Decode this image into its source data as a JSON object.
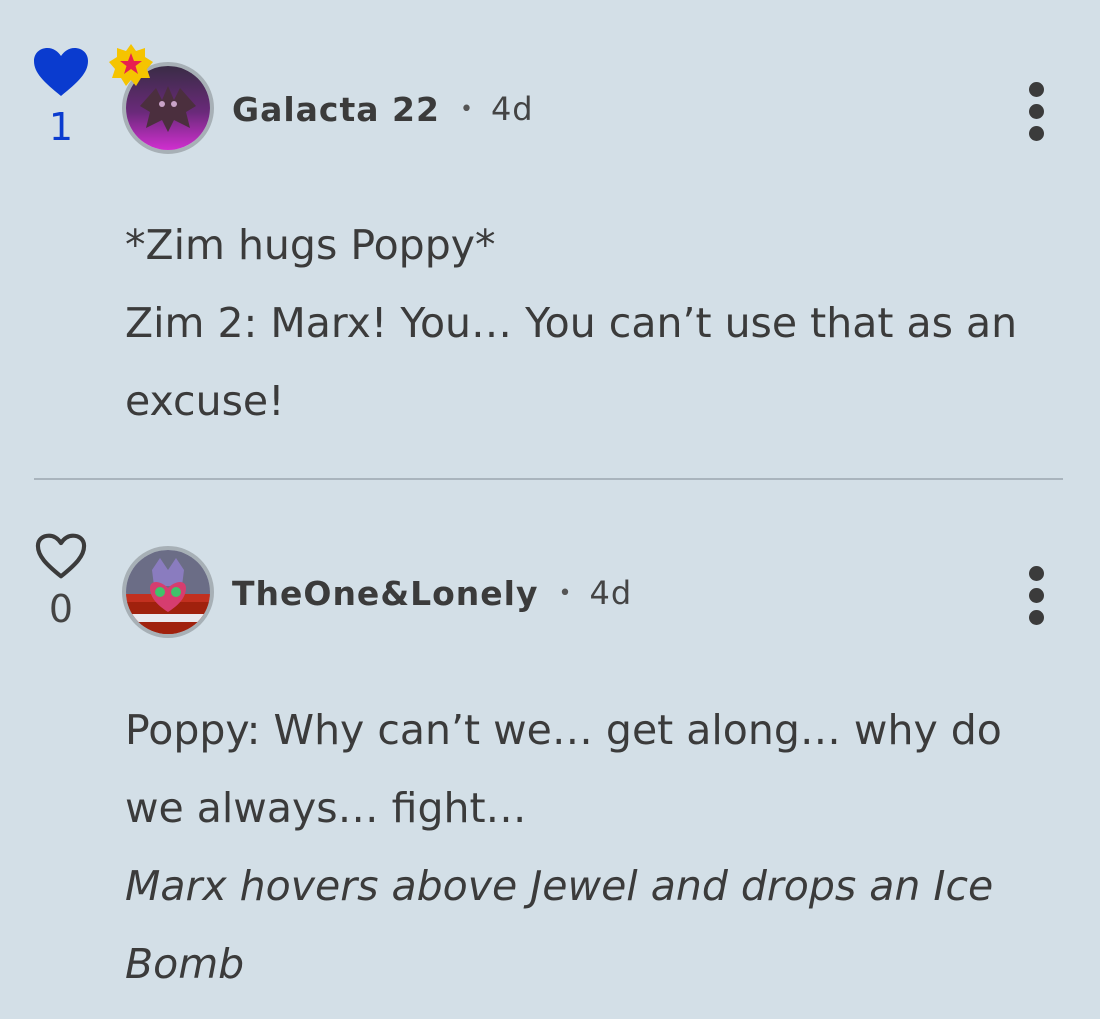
{
  "comments": [
    {
      "author": "Galacta 22",
      "separator": "•",
      "time": "4d",
      "likes": "1",
      "liked": true,
      "badge": "star-badge",
      "lines": [
        "*Zim hugs Poppy*",
        "Zim 2: Marx! You… You can’t use that as an excuse!"
      ]
    },
    {
      "author": "TheOne&Lonely",
      "separator": "•",
      "time": "4d",
      "likes": "0",
      "liked": false,
      "lines": [
        "Poppy: Why can’t we… get along… why do we always… fight…"
      ],
      "italic_lines": [
        "Marx hovers above Jewel and drops an Ice Bomb"
      ]
    }
  ],
  "colors": {
    "background": "#d3dfe7",
    "liked_heart": "#0a3bcf",
    "text": "#3b3b3b",
    "badge_gold": "#f5c400",
    "badge_star": "#e8204f"
  }
}
